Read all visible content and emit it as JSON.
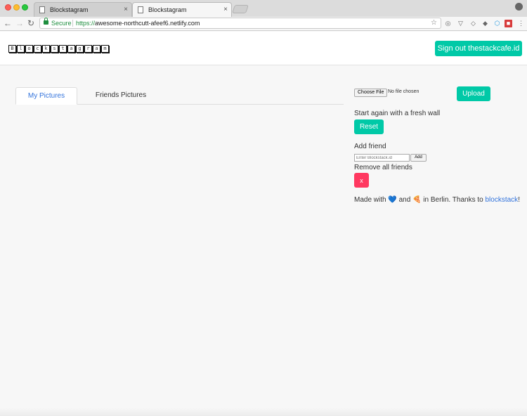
{
  "browser": {
    "tabs": [
      {
        "title": "Blockstagram",
        "close": "×"
      },
      {
        "title": "Blockstagram",
        "close": "×"
      }
    ],
    "nav": {
      "back": "←",
      "forward": "→",
      "reload": "↻"
    },
    "address": {
      "secure_label": "Secure",
      "scheme": "https://",
      "host": "awesome-northcutt-afeef6.netlify.com"
    },
    "star": "☆",
    "extensions": [
      "◎",
      "▽",
      "◇",
      "◆",
      "⬡",
      "■"
    ],
    "menu": "⋮"
  },
  "header": {
    "logo_letters": [
      "B",
      "l",
      "o",
      "c",
      "k",
      "s",
      "t",
      "a",
      "g",
      "r",
      "a",
      "m"
    ],
    "signout_label": "Sign out thestackcafe.id"
  },
  "main": {
    "tabs": [
      {
        "label": "My Pictures"
      },
      {
        "label": "Friends Pictures"
      }
    ]
  },
  "panel": {
    "choose_file": "Choose File",
    "file_status": "No file chosen",
    "upload_label": "Upload",
    "reset_text": "Start again with a fresh wall",
    "reset_label": "Reset",
    "add_friend_text": "Add friend",
    "friend_placeholder": "Enter Blockstack.id",
    "add_label": "Add",
    "remove_text": "Remove all friends",
    "remove_label": "x",
    "credits": {
      "prefix": "Made with",
      "heart": "💙",
      "and": "and",
      "pizza": "🍕",
      "suffix": "in Berlin. Thanks to",
      "link": "blockstack",
      "end": "!"
    }
  },
  "colors": {
    "accent": "#00c9a7",
    "danger": "#ff3860",
    "link": "#3273dc"
  }
}
